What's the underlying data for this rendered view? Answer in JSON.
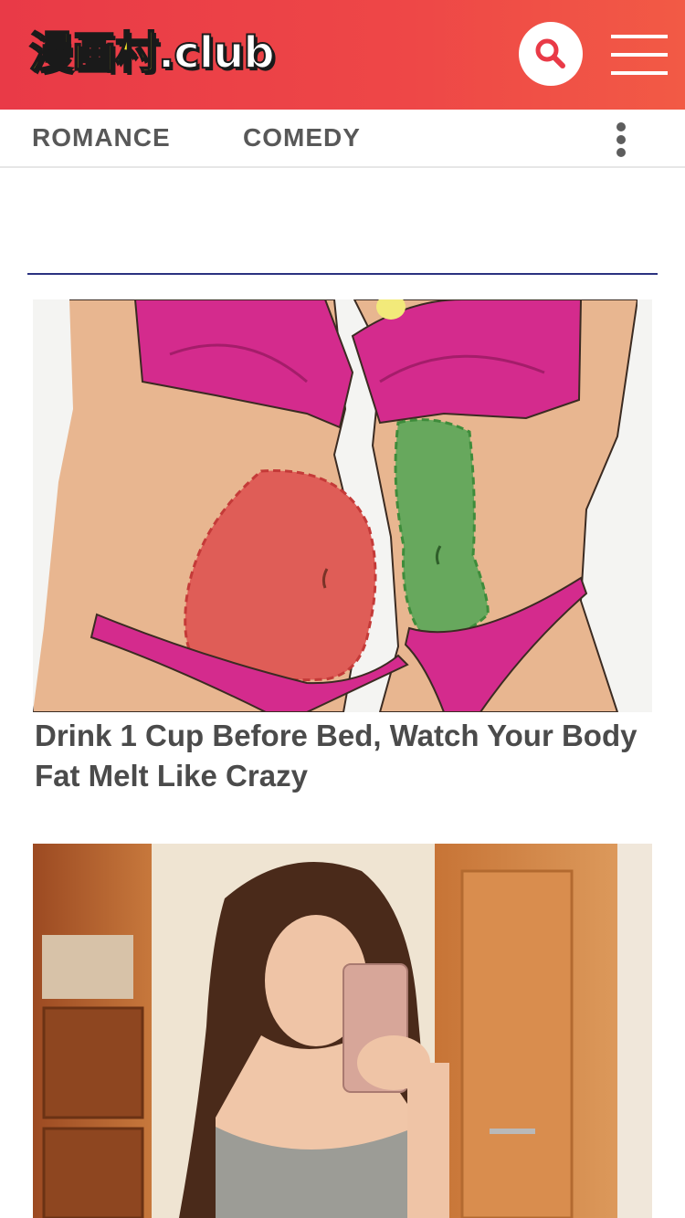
{
  "header": {
    "logo_main": "漫画村",
    "logo_suffix": ".club",
    "search_icon": "search-icon",
    "menu_icon": "hamburger-menu-icon"
  },
  "nav": {
    "items": [
      {
        "label": "ROMANCE"
      },
      {
        "label": "COMEDY"
      }
    ],
    "more_icon": "vertical-dots-icon"
  },
  "articles": [
    {
      "title": "Drink 1 Cup Before Bed, Watch Your Body Fat Melt Like Crazy"
    }
  ],
  "colors": {
    "header_red": "#ec4049",
    "divider_navy": "#2b3280",
    "logo_yellow": "#fff32a",
    "text_gray": "#4b4b4b"
  }
}
